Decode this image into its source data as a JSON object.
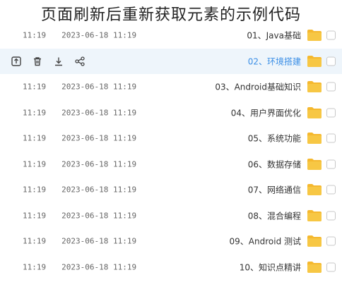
{
  "header": {
    "title": "页面刷新后重新获取元素的示例代码"
  },
  "rows": [
    {
      "name": "01、Java基础",
      "date": "2023-06-",
      "time": "11:19",
      "day": "18",
      "active": false
    },
    {
      "name": "02、环境搭建",
      "active": true
    },
    {
      "name": "03、Android基础知识",
      "date": "2023-06-",
      "day": "18",
      "time": "11:19",
      "active": false
    },
    {
      "name": "04、用户界面优化",
      "date": "2023-06-",
      "day": "18",
      "time": "11:19",
      "active": false
    },
    {
      "name": "05、系统功能",
      "date": "2023-06-",
      "day": "18",
      "time": "11:19",
      "active": false
    },
    {
      "name": "06、数据存储",
      "date": "2023-06-",
      "day": "18",
      "time": "11:19",
      "active": false
    },
    {
      "name": "07、网络通信",
      "date": "2023-06-",
      "day": "18",
      "time": "11:19",
      "active": false
    },
    {
      "name": "08、混合编程",
      "date": "2023-06-",
      "day": "18",
      "time": "11:19",
      "active": false
    },
    {
      "name": "09、Android 测试",
      "date": "2023-06-",
      "day": "18",
      "time": "11:19",
      "active": false
    },
    {
      "name": "10、知识点精讲",
      "date": "2023-06-",
      "day": "18",
      "time": "11:19",
      "active": false
    }
  ],
  "row_prefix": {
    "left": "11:19"
  },
  "actions": [
    "upload-icon",
    "delete-icon",
    "download-icon",
    "share-icon"
  ],
  "colors": {
    "folder": "#f7c744",
    "folder_tab": "#f5b82e",
    "active_bg": "#eef5fb",
    "active_text": "#3a8ee6"
  }
}
